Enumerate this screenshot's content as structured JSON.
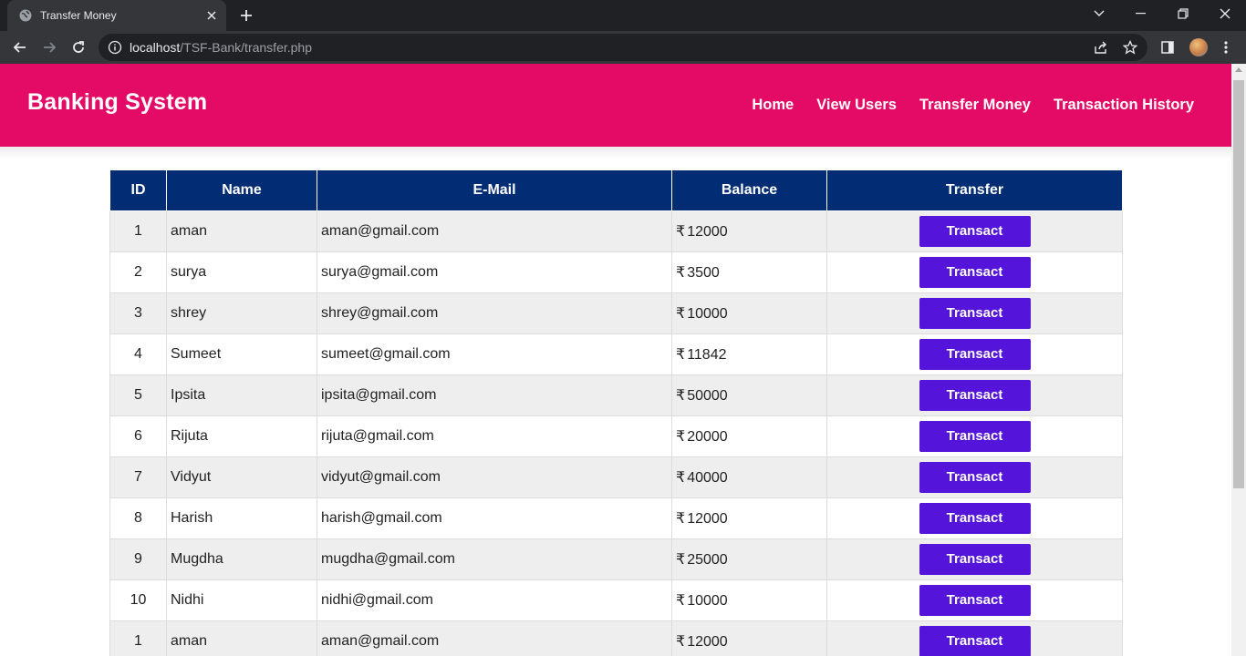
{
  "browser": {
    "tab_title": "Transfer Money",
    "url_host": "localhost",
    "url_path": "/TSF-Bank/transfer.php"
  },
  "site": {
    "brand": "Banking System",
    "nav": [
      "Home",
      "View Users",
      "Transfer Money",
      "Transaction History"
    ]
  },
  "table": {
    "headers": [
      "ID",
      "Name",
      "E-Mail",
      "Balance",
      "Transfer"
    ],
    "currency_symbol": "₹",
    "button_label": "Transact",
    "rows": [
      {
        "id": "1",
        "name": "aman",
        "email": "aman@gmail.com",
        "balance": "12000"
      },
      {
        "id": "2",
        "name": "surya",
        "email": "surya@gmail.com",
        "balance": "3500"
      },
      {
        "id": "3",
        "name": "shrey",
        "email": "shrey@gmail.com",
        "balance": "10000"
      },
      {
        "id": "4",
        "name": "Sumeet",
        "email": "sumeet@gmail.com",
        "balance": "11842"
      },
      {
        "id": "5",
        "name": "Ipsita",
        "email": "ipsita@gmail.com",
        "balance": "50000"
      },
      {
        "id": "6",
        "name": "Rijuta",
        "email": "rijuta@gmail.com",
        "balance": "20000"
      },
      {
        "id": "7",
        "name": "Vidyut",
        "email": "vidyut@gmail.com",
        "balance": "40000"
      },
      {
        "id": "8",
        "name": "Harish",
        "email": "harish@gmail.com",
        "balance": "12000"
      },
      {
        "id": "9",
        "name": "Mugdha",
        "email": "mugdha@gmail.com",
        "balance": "25000"
      },
      {
        "id": "10",
        "name": "Nidhi",
        "email": "nidhi@gmail.com",
        "balance": "10000"
      },
      {
        "id": "1",
        "name": "aman",
        "email": "aman@gmail.com",
        "balance": "12000"
      }
    ]
  },
  "colors": {
    "navbar": "#e40b66",
    "table_header": "#022c73",
    "button": "#5414d9"
  }
}
